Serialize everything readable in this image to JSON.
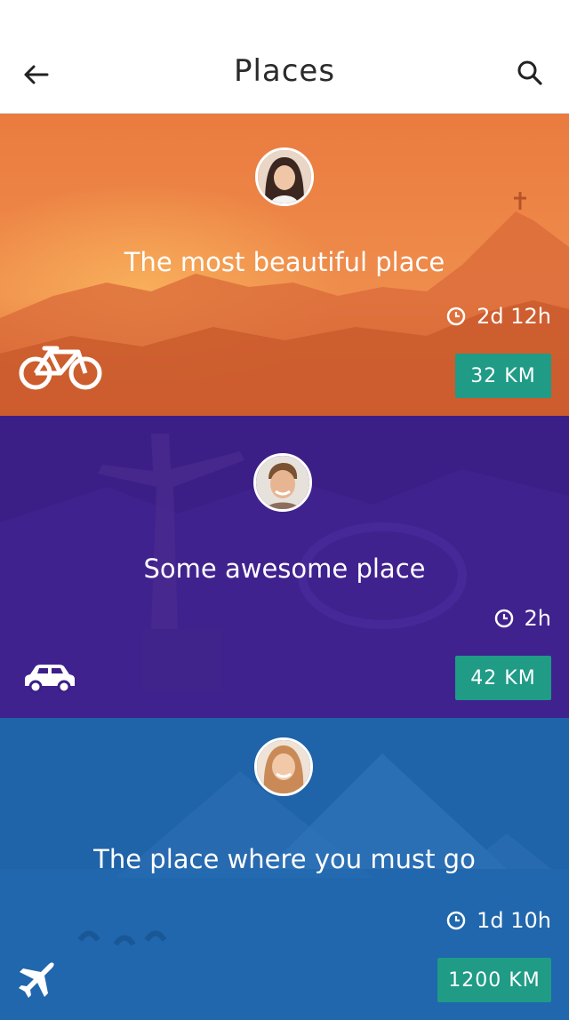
{
  "header": {
    "title": "Places"
  },
  "places": [
    {
      "title": "The most beautiful place",
      "duration": "2d 12h",
      "distance": "32 KM",
      "transport": "bicycle-icon",
      "theme_color": "#e8783a"
    },
    {
      "title": "Some awesome place",
      "duration": "2h",
      "distance": "42 KM",
      "transport": "car-icon",
      "theme_color": "#3c1f86"
    },
    {
      "title": "The place where you must go",
      "duration": "1d 10h",
      "distance": "1200 KM",
      "transport": "airplane-icon",
      "theme_color": "#1f63a8"
    }
  ],
  "colors": {
    "accent": "#1f9b86",
    "header_bg": "#ffffff"
  }
}
